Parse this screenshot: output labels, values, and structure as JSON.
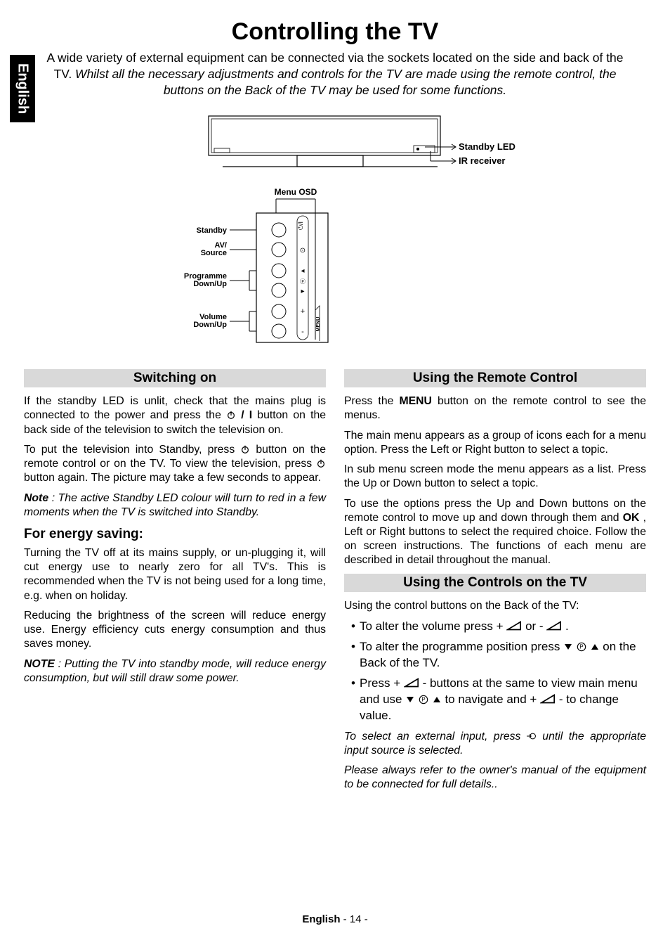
{
  "side_tab": "English",
  "page_title": "Controlling the TV",
  "intro_plain": "A wide variety of external equipment can be connected via the sockets located on the side and back of the TV. ",
  "intro_italic": "Whilst all the necessary adjustments and controls for the TV are made using the remote control, the buttons on the Back of the TV  may be used for some functions.",
  "diagram": {
    "menu_osd": "Menu OSD",
    "standby": "Standby",
    "av_source": "AV/\nSource",
    "prog": "Programme\nDown/Up",
    "volume": "Volume\nDown/Up",
    "standby_led": "Standby LED",
    "ir_receiver": "IR receiver",
    "panel_icons": {
      "standby": "⏻",
      "source": "⊙",
      "prev": "◂",
      "next": "▸",
      "p_symbol": "ⓟ",
      "plus": "+",
      "minus": "-",
      "menu": "MENU"
    }
  },
  "left": {
    "h_switching": "Switching on",
    "p1a": "If the standby LED is unlit, check that the mains plug is connected to the power and press the ",
    "p1b": "/ I",
    "p1c": " button on the back side of the television to switch the television on.",
    "p2a": "To put the television into Standby, press ",
    "p2b": " button on the remote control or on the TV. To view the television, press ",
    "p2c": " button again. The picture may take a few seconds to appear.",
    "p3_note_label": "Note",
    "p3_note_body": ": The active Standby LED colour will turn to red in a few moments when the TV is switched into Standby.",
    "h_energy": "For energy saving:",
    "p4": "Turning the TV off at its mains supply, or un-plugging it, will cut energy use to nearly zero for all TV's. This is recommended when the TV is not being used for a long time, e.g. when on holiday.",
    "p5": "Reducing the brightness of the screen will reduce energy use. Energy efficiency cuts energy consumption and thus saves money.",
    "p6_note_label": "NOTE",
    "p6_note_body": ": Putting the TV into standby mode, will reduce energy consumption, but will still draw some power."
  },
  "right": {
    "h_remote": "Using the Remote Control",
    "r1a": "Press the ",
    "r1b": "MENU",
    "r1c": " button on the remote control to see the menus.",
    "r2": "The main menu appears as a group of icons each for a menu option. Press the Left or Right button to select a topic.",
    "r3": "In sub menu screen mode the menu appears as a list. Press the Up or Down button to select a topic.",
    "r4a": "To use the options press the Up and Down buttons on the remote control to move up and down through them and ",
    "r4b": "OK",
    "r4c": ", Left or Right buttons to select the required choice. Follow the on screen instructions. The functions of each menu are described in detail throughout the manual.",
    "h_tvctrl": "Using the Controls on the TV",
    "tv_line": "Using the control buttons on the Back of the TV:",
    "b1a": "To alter the volume press ",
    "b1b": " or ",
    "b2a": "To alter the programme position press ",
    "b2b": " on the Back of the TV.",
    "b3a": "Press ",
    "b3b": " buttons at the same to view main menu and use ",
    "b3c": " to navigate and ",
    "b3d": " to change value.",
    "r5a": "To select an external input, press ",
    "r5b": "  until the appropriate input source is selected.",
    "r6": "Please always refer to the owner's manual of the equipment to be connected for full details..",
    "sym_plus": "+",
    "sym_minus": "-",
    "sym_dot": "."
  },
  "footer": {
    "lang": "English",
    "sep": "   - ",
    "page": "14",
    "after": " -"
  }
}
